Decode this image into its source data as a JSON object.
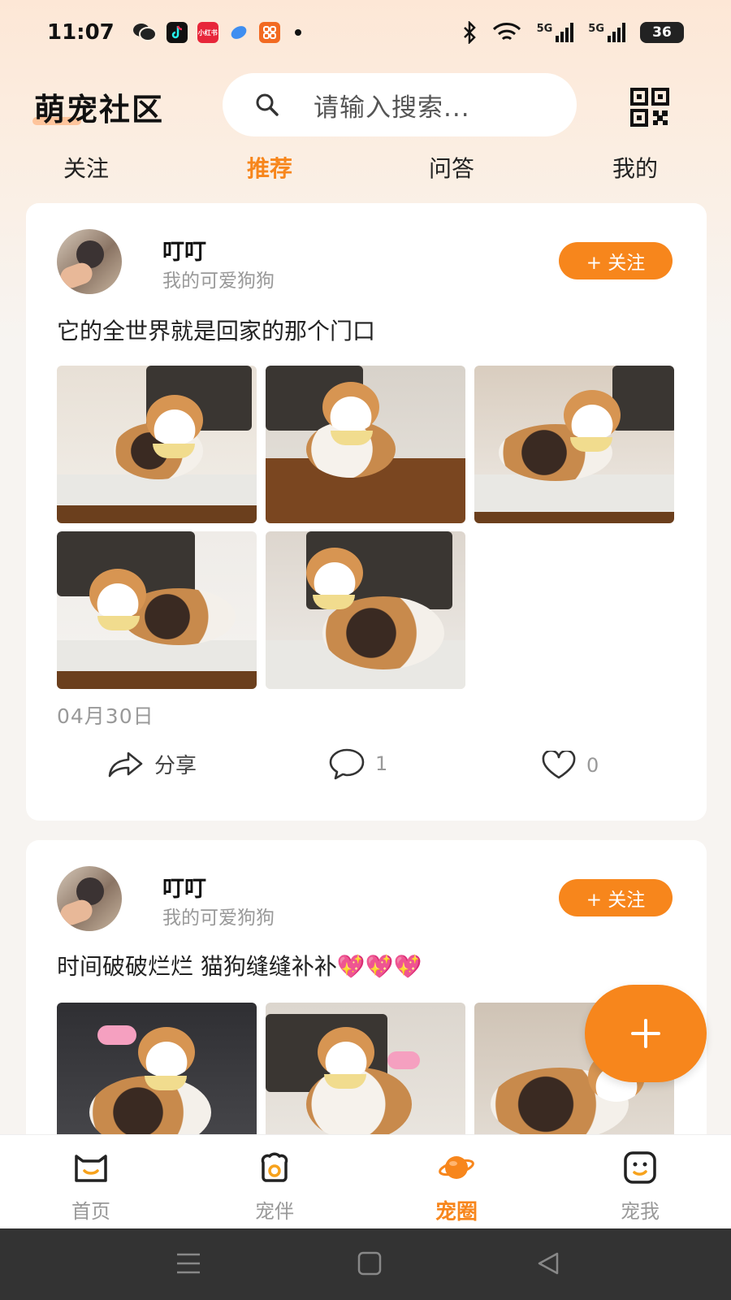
{
  "status_bar": {
    "time": "11:07",
    "app_icons": [
      "wechat-icon",
      "tiktok-icon",
      "xiaohongshu-icon",
      "chat-icon",
      "grid-app-icon"
    ],
    "xiaohongshu_text": "小红书",
    "network_label_1": "5G",
    "network_label_2": "5G",
    "battery": "36"
  },
  "header": {
    "title": "萌宠社区",
    "search_placeholder": "请输入搜索...",
    "qr_icon": "qr-code-icon"
  },
  "tabs": [
    {
      "label": "关注",
      "active": false
    },
    {
      "label": "推荐",
      "active": true
    },
    {
      "label": "问答",
      "active": false
    },
    {
      "label": "我的",
      "active": false
    }
  ],
  "posts": [
    {
      "username": "叮叮",
      "subtitle": "我的可爱狗狗",
      "follow_label": "+ 关注",
      "text": "它的全世界就是回家的那个门口",
      "photo_count": 5,
      "date": "04月30日",
      "share_label": "分享",
      "comment_count": "1",
      "like_count": "0"
    },
    {
      "username": "叮叮",
      "subtitle": "我的可爱狗狗",
      "follow_label": "+ 关注",
      "text": "时间破破烂烂 猫狗缝缝补补💖💖💖",
      "photo_count": 3
    }
  ],
  "fab": {
    "icon": "plus-icon"
  },
  "bottom_nav": [
    {
      "label": "首页",
      "icon": "home-cat-icon",
      "active": false
    },
    {
      "label": "宠伴",
      "icon": "pet-companion-icon",
      "active": false
    },
    {
      "label": "宠圈",
      "icon": "planet-icon",
      "active": true
    },
    {
      "label": "宠我",
      "icon": "smile-face-icon",
      "active": false
    }
  ],
  "colors": {
    "accent": "#f7861c",
    "background": "#f7f4f1",
    "header_gradient": "#fde7d6"
  }
}
